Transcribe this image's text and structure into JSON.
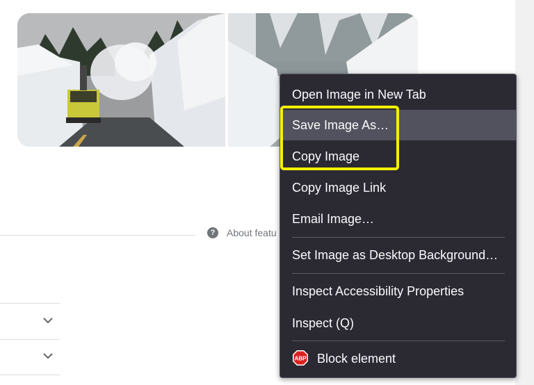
{
  "context_menu": {
    "items": [
      {
        "label": "Open Image in New Tab"
      },
      {
        "label": "Save Image As…"
      },
      {
        "label": "Copy Image"
      },
      {
        "label": "Copy Image Link"
      },
      {
        "label": "Email Image…"
      },
      {
        "label": "Set Image as Desktop Background…"
      },
      {
        "label": "Inspect Accessibility Properties"
      },
      {
        "label": "Inspect (Q)"
      },
      {
        "label": "Block element"
      }
    ],
    "hovered_item": "Save Image As…",
    "abp_badge": "ABP"
  },
  "page": {
    "about_text": "About featu",
    "help_icon": "?"
  },
  "colors": {
    "menu_bg": "#2b2a33",
    "menu_hover": "#52525e",
    "highlight": "#f6f000"
  },
  "icons": [
    "help-icon",
    "chevron-down-icon",
    "abp-icon"
  ]
}
